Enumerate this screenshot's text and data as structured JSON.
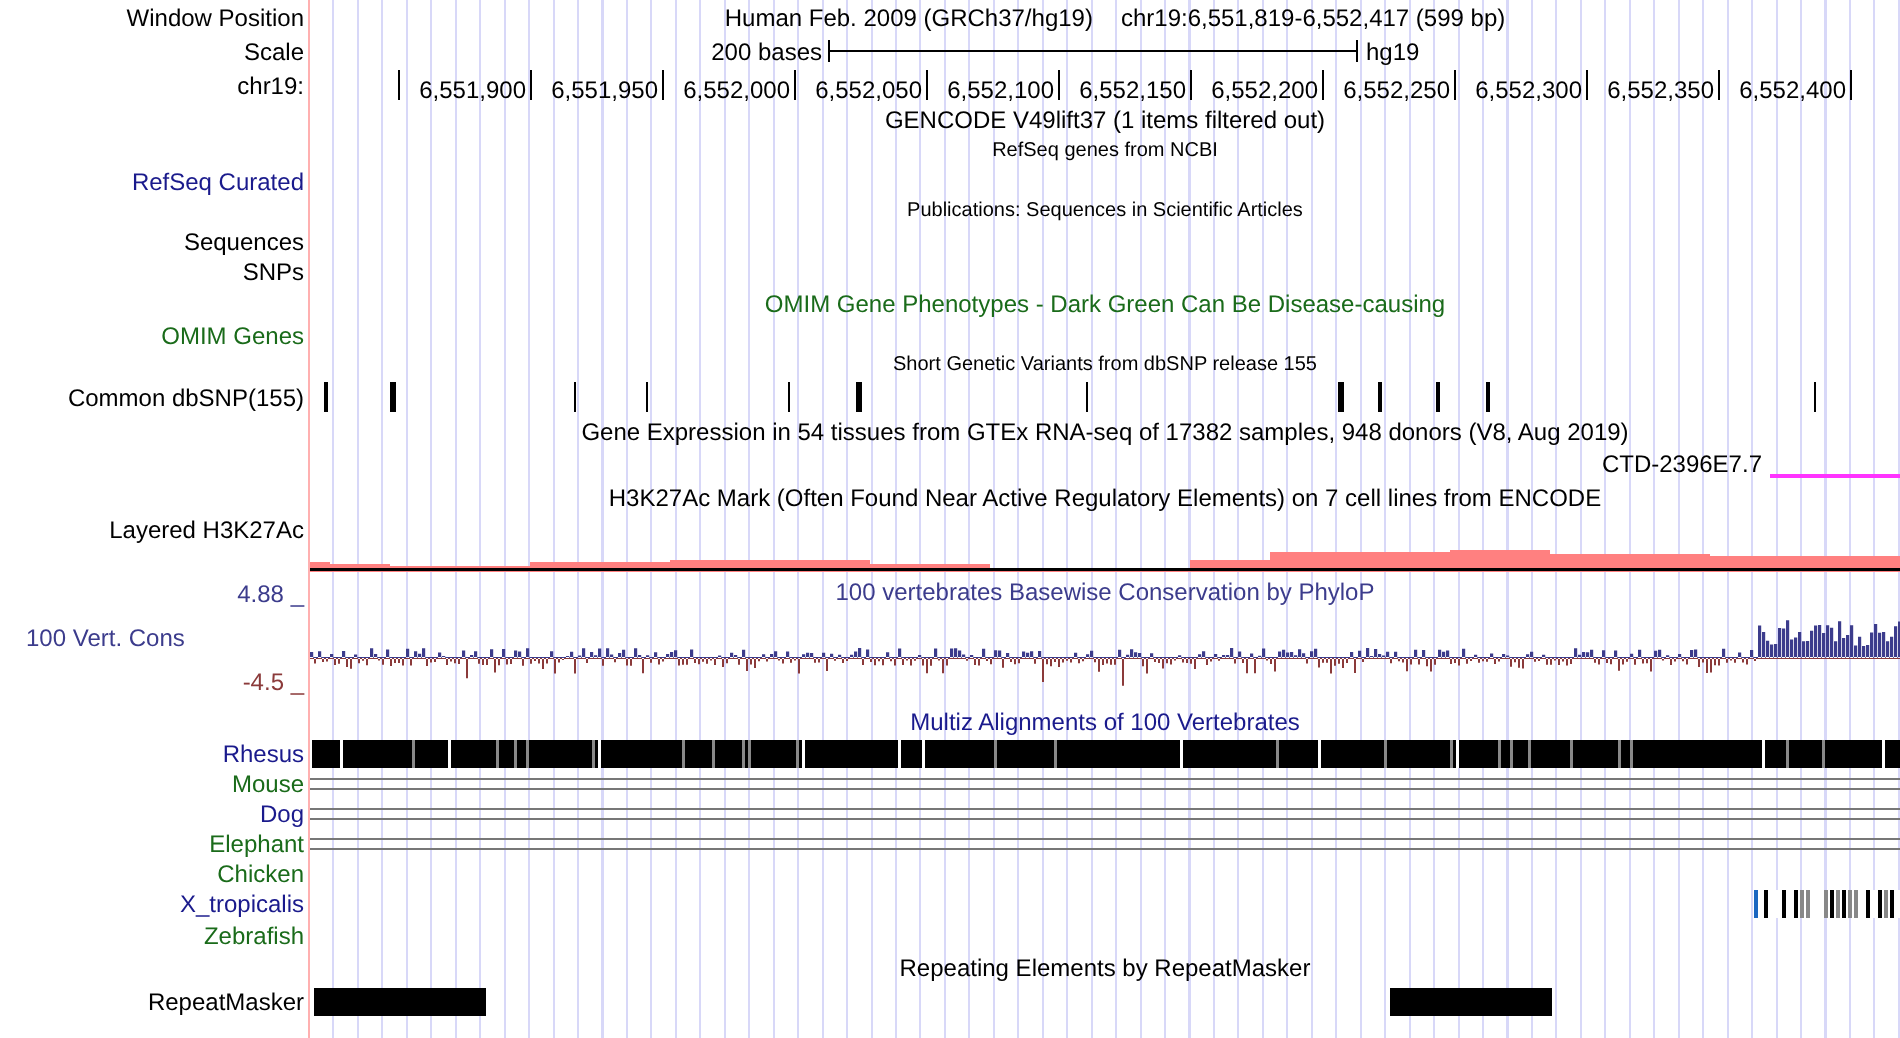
{
  "header": {
    "label": "Window Position",
    "assembly": "Human Feb. 2009 (GRCh37/hg19)",
    "position": "chr19:6,551,819-6,552,417 (599 bp)"
  },
  "scale": {
    "label": "Scale",
    "length": "200 bases",
    "db": "hg19"
  },
  "ruler": {
    "label": "chr19:",
    "ticks": [
      "6,551,900",
      "6,551,950",
      "6,552,000",
      "6,552,050",
      "6,552,100",
      "6,552,150",
      "6,552,200",
      "6,552,250",
      "6,552,300",
      "6,552,350",
      "6,552,400"
    ]
  },
  "tracks": [
    {
      "kind": "title",
      "title": "GENCODE V49lift37 (1 items filtered out)",
      "color": "#000000"
    },
    {
      "kind": "note",
      "title": "RefSeq genes from NCBI"
    },
    {
      "kind": "label",
      "label": "RefSeq Curated",
      "color": "#1a1a8c"
    },
    {
      "kind": "note",
      "title": "Publications: Sequences in Scientific Articles"
    },
    {
      "kind": "label",
      "label": "Sequences",
      "color": "#000000"
    },
    {
      "kind": "label",
      "label": "SNPs",
      "color": "#000000"
    },
    {
      "kind": "title",
      "title": "OMIM Gene Phenotypes - Dark Green Can Be Disease-causing",
      "color": "#1a6b1a"
    },
    {
      "kind": "label",
      "label": "OMIM Genes",
      "color": "#1a6b1a"
    },
    {
      "kind": "note",
      "title": "Short Genetic Variants from dbSNP release 155"
    },
    {
      "kind": "snp",
      "label": "Common dbSNP(155)",
      "color": "#000000"
    },
    {
      "kind": "title",
      "title": "Gene Expression in 54 tissues from GTEx RNA-seq of 17382 samples, 948 donors (V8, Aug 2019)",
      "color": "#000000"
    },
    {
      "kind": "gene",
      "name": "CTD-2396E7.7",
      "color": "#ff33ff"
    },
    {
      "kind": "title",
      "title": "H3K27Ac Mark (Often Found Near Active Regulatory Elements) on 7 cell lines from ENCODE",
      "color": "#000000"
    },
    {
      "kind": "label",
      "label": "Layered H3K27Ac",
      "color": "#000000"
    },
    {
      "kind": "signal",
      "color": "#ff8080"
    },
    {
      "kind": "wiggle",
      "title": "100 vertebrates Basewise Conservation by PhyloP",
      "label": "100 Vert. Cons",
      "max": "4.88 _",
      "min": "-4.5 _",
      "color": "#3c3c8c"
    },
    {
      "kind": "title",
      "title": "Multiz Alignments of 100 Vertebrates",
      "color": "#1a1a8c"
    },
    {
      "kind": "block",
      "label": "Rhesus",
      "color": "#1a1a8c"
    },
    {
      "kind": "line",
      "label": "Mouse",
      "color": "#1a6b1a"
    },
    {
      "kind": "line",
      "label": "Dog",
      "color": "#1a1a8c"
    },
    {
      "kind": "line",
      "label": "Elephant",
      "color": "#1a6b1a"
    },
    {
      "kind": "label",
      "label": "Chicken",
      "color": "#1a6b1a"
    },
    {
      "kind": "tail",
      "label": "X_tropicalis",
      "color": "#1a1a8c"
    },
    {
      "kind": "label",
      "label": "Zebrafish",
      "color": "#1a6b1a"
    },
    {
      "kind": "title",
      "title": "Repeating Elements by RepeatMasker",
      "color": "#000000"
    },
    {
      "kind": "repeat",
      "label": "RepeatMasker",
      "color": "#000000"
    }
  ]
}
